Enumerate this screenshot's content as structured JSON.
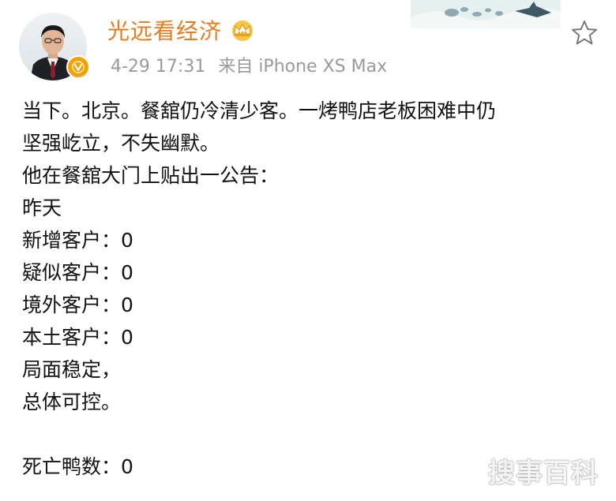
{
  "user": {
    "name": "光远看经济",
    "verified_badge": "V",
    "timestamp": "4-29 17:31",
    "source": "来自 iPhone XS Max"
  },
  "icons": {
    "crown": "crown-icon",
    "star": "star-icon",
    "verified": "verified-badge-icon"
  },
  "colors": {
    "username": "#e87b1f",
    "meta": "#9a9a9a",
    "badge": "#f5a200"
  },
  "post": {
    "lines": [
      "当下。北京。餐舘仍冷清少客。一烤鸭店老板困难中仍",
      "坚强屹立，不失幽默。",
      "他在餐舘大门上贴出一公告：",
      "昨天",
      "新增客户：0",
      "疑似客户：0",
      "境外客户：0",
      "本土客户：0",
      "局面稳定，",
      "总体可控。",
      "",
      "死亡鸭数：0"
    ]
  },
  "watermark": "搜事百科"
}
